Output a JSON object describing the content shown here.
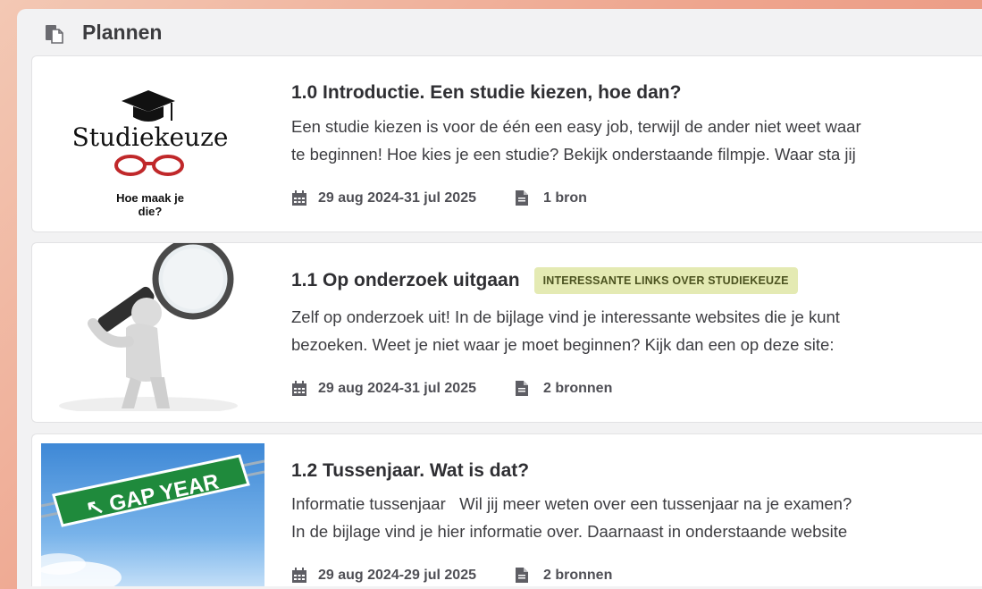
{
  "section": {
    "title": "Plannen",
    "icon": "plan-documents-icon"
  },
  "cards": [
    {
      "title": "1.0 Introductie. Een studie kiezen, hoe dan?",
      "tag": "",
      "description_lines": [
        "Een studie kiezen is voor de één een easy job, terwijl de ander niet weet waar",
        "te beginnen! Hoe kies je een studie? Bekijk onderstaande filmpje. Waar sta jij"
      ],
      "date_range": "29 aug 2024-31 jul 2025",
      "sources": "1 bron",
      "thumbnail": {
        "text_main": "Studiekeuze",
        "text_sub_1": "Hoe maak je",
        "text_sub_2": "die?"
      }
    },
    {
      "title": "1.1 Op onderzoek uitgaan",
      "tag": "INTERESSANTE LINKS OVER STUDIEKEUZE",
      "description_lines": [
        "Zelf op onderzoek uit! In de bijlage vind je interessante websites die je kunt",
        "bezoeken. Weet je niet waar je moet beginnen? Kijk dan een op deze site:"
      ],
      "date_range": "29 aug 2024-31 jul 2025",
      "sources": "2 bronnen"
    },
    {
      "title": "1.2 Tussenjaar. Wat is dat?",
      "tag": "",
      "description_lines": [
        "Informatie tussenjaar   Wil jij meer weten over een tussenjaar na je examen?",
        "In de bijlage vind je hier informatie over. Daarnaast in onderstaande website"
      ],
      "date_range": "29 aug 2024-29 jul 2025",
      "sources": "2 bronnen",
      "thumbnail": {
        "sign_text": "GAP YEAR"
      }
    }
  ],
  "colors": {
    "accent_tag_bg": "#e4eab3",
    "text_dark": "#2f2f33",
    "icon_gray": "#6b6b70"
  }
}
